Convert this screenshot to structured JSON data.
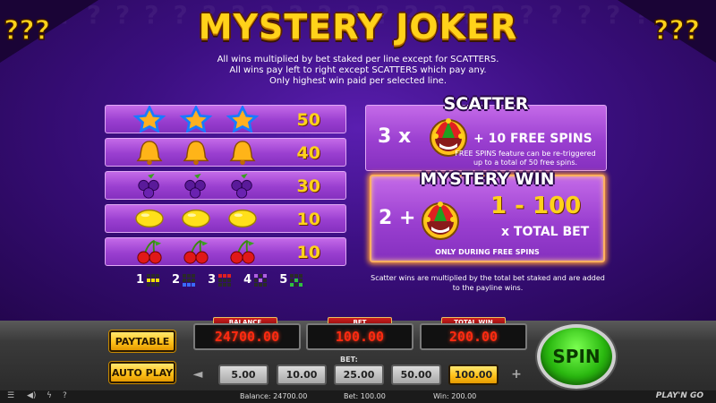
{
  "title": "MYSTERY JOKER",
  "rules": [
    "All wins multiplied by bet staked per line except for SCATTERS.",
    "All wins pay left to right except SCATTERS which pay any.",
    "Only highest win paid per selected line."
  ],
  "paytable": [
    {
      "symbol": "star-icon",
      "value": "50"
    },
    {
      "symbol": "bell-icon",
      "value": "40"
    },
    {
      "symbol": "plum-icon",
      "value": "30"
    },
    {
      "symbol": "lemon-icon",
      "value": "10"
    },
    {
      "symbol": "cherry-icon",
      "value": "10"
    }
  ],
  "lines": [
    {
      "num": "1",
      "color": "#f0e000"
    },
    {
      "num": "2",
      "color": "#3a6aff"
    },
    {
      "num": "3",
      "color": "#e02020"
    },
    {
      "num": "4",
      "color": "#b060e0"
    },
    {
      "num": "5",
      "color": "#30c040"
    }
  ],
  "scatter": {
    "title": "SCATTER",
    "count": "3 x",
    "prize": "+ 10 FREE SPINS",
    "note": "FREE SPINS feature can be re-triggered up to a total of 50 free spins."
  },
  "mystery": {
    "title": "MYSTERY WIN",
    "count": "2 +",
    "range": "1 - 100",
    "mult": "x TOTAL BET",
    "only": "ONLY DURING FREE SPINS"
  },
  "scatter_note": "Scatter wins are multiplied by the total bet staked and are added to the payline wins.",
  "controls": {
    "paytable_label": "PAYTABLE",
    "autoplay_label": "AUTO PLAY",
    "balance_label": "BALANCE",
    "balance_value": "24700.00",
    "bet_label": "BET",
    "bet_value": "100.00",
    "totalwin_label": "TOTAL WIN",
    "totalwin_value": "200.00",
    "bet_select_label": "BET:",
    "bet_options": [
      "5.00",
      "10.00",
      "25.00",
      "50.00",
      "100.00"
    ],
    "selected_bet": "100.00",
    "prev_arrow": "◄",
    "next_arrow": "+",
    "spin_label": "SPIN"
  },
  "status": {
    "balance": "Balance: 24700.00",
    "bet": "Bet: 100.00",
    "win": "Win: 200.00",
    "logo": "PLAY'N GO"
  },
  "colors": {
    "gold": "#ffd21a",
    "purple_panel": "#9a3fd0",
    "meter_red": "#ff2a10",
    "spin_green": "#2ab810"
  }
}
